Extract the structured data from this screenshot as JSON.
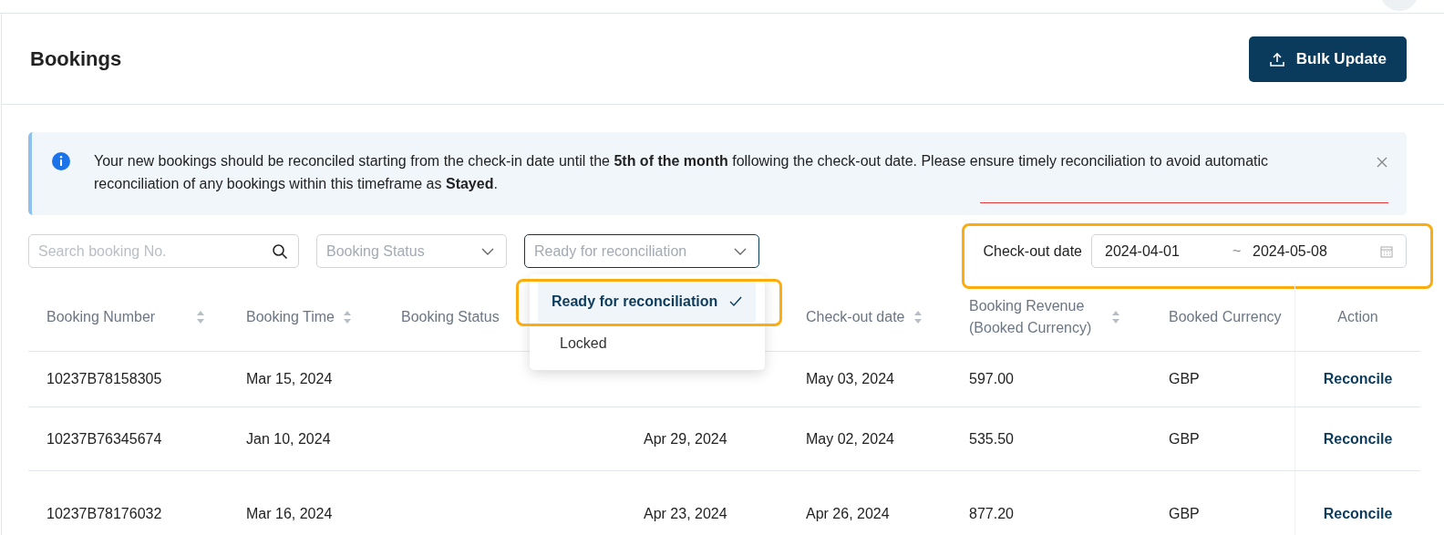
{
  "page": {
    "title": "Bookings",
    "bulk_button": "Bulk Update"
  },
  "notice": {
    "text": "Your new bookings should be reconciled starting from the check-in date until the **5th of the month** following the check-out date. Please ensure timely reconciliation to avoid automatic reconciliation of any bookings within this timeframe as **Stayed**."
  },
  "filters": {
    "search": {
      "placeholder": "Search booking No."
    },
    "status": {
      "placeholder": "Booking Status"
    },
    "reconciliation": {
      "placeholder": "Ready for reconciliation",
      "open": true
    },
    "checkout": {
      "label": "Check-out date",
      "from": "2024-04-01",
      "separator": "~",
      "to": "2024-05-08"
    }
  },
  "dropdown_options": [
    {
      "label": "Ready for reconciliation",
      "selected": true
    },
    {
      "label": "Locked",
      "selected": false
    }
  ],
  "table": {
    "columns": [
      {
        "label": "Booking Number",
        "sortable": true
      },
      {
        "label": "Booking Time",
        "sortable": true
      },
      {
        "label": "Booking Status",
        "sortable": false
      },
      {
        "label": "Check-out date",
        "sortable": true
      },
      {
        "label": "Booking Revenue\n(Booked Currency)",
        "sortable": true
      },
      {
        "label": "Booked Currency",
        "sortable": false
      },
      {
        "label": "Action",
        "sortable": false
      }
    ],
    "rows": [
      {
        "booking_number": "10237B78158305",
        "booking_time": "Mar 15, 2024",
        "check_out": "May 03, 2024",
        "revenue": "597.00",
        "currency": "GBP",
        "action": "Reconcile"
      },
      {
        "booking_number": "10237B76345674",
        "booking_time": "Jan 10, 2024",
        "column_4": "Apr 29, 2024",
        "check_out": "May 02, 2024",
        "revenue": "535.50",
        "currency": "GBP",
        "action": "Reconcile"
      },
      {
        "booking_number": "10237B78176032",
        "booking_time": "Mar 16, 2024",
        "column_4": "Apr 23, 2024",
        "check_out": "Apr 26, 2024",
        "revenue": "877.20",
        "currency": "GBP",
        "action": "Reconcile"
      }
    ]
  }
}
